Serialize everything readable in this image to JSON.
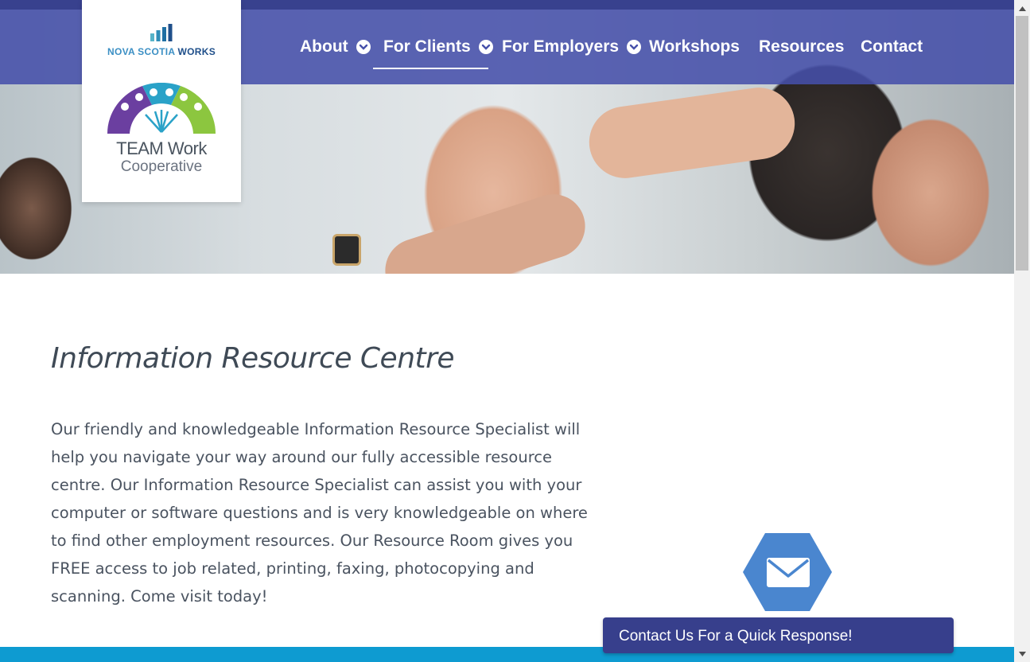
{
  "nav": {
    "items": [
      {
        "label": "About",
        "has_dropdown": true
      },
      {
        "label": "For Clients",
        "has_dropdown": true,
        "active": true
      },
      {
        "label": "For Employers",
        "has_dropdown": true
      },
      {
        "label": "Workshops",
        "has_dropdown": false
      },
      {
        "label": "Resources",
        "has_dropdown": false
      },
      {
        "label": "Contact",
        "has_dropdown": false
      }
    ]
  },
  "logo": {
    "nsw_part1": "NOVA SCOTIA",
    "nsw_part2": "WORKS",
    "team_name": "TEAM Work",
    "team_sub": "Cooperative"
  },
  "main": {
    "title": "Information Resource Centre",
    "body": "Our friendly and knowledgeable Information Resource Specialist will help you navigate your way around our fully accessible resource centre. Our Information Resource Specialist can assist you with your computer or software questions and is very knowledgeable on where to find other employment resources. Our Resource Room gives you FREE access to job related, printing, faxing, photocopying and scanning. Come visit today!"
  },
  "contact_widget": {
    "icon": "envelope-icon",
    "label": "Contact Us For a Quick Response!"
  },
  "colors": {
    "nav_bg": "#4650aa",
    "top_strip": "#38418e",
    "contact_bar": "#373f8c",
    "hex_blue": "#4a86cf",
    "bottom_band": "#0e9bd1",
    "text": "#4a5360"
  }
}
